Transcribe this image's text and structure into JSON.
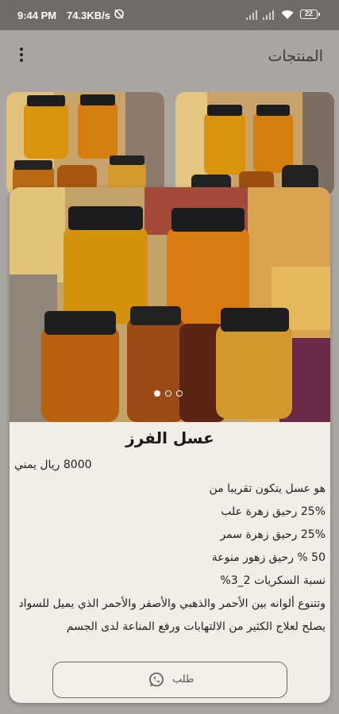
{
  "status_bar": {
    "time": "9:44 PM",
    "network_speed": "74.3KB/s",
    "battery": "22"
  },
  "app_bar": {
    "title": "المنتجات",
    "menu_icon": "more-vertical-icon"
  },
  "product": {
    "name": "عسل الفرز",
    "price": "8000 ريال يمني",
    "description": [
      "هو عسل يتكون تقريبا من",
      "25% رحيق زهرة علب",
      "25%  رحيق زهرة سمر",
      "50 % رحيق زهور منوعة",
      "نسبة السكريات 2_3%",
      "وتتنوع ألوانه بين الأحمر والذهبي والأصفر والأحمر الذي يميل للسواد",
      "يصلح لعلاج الكثير من الالتهابات ورفع المناعة لدى الجسم"
    ],
    "carousel": {
      "total": 3,
      "active": 0
    },
    "order_label": "طلب"
  },
  "colors": {
    "background": "#a9a5a1",
    "card": "#f2ede6",
    "honey": "#d08a17",
    "whatsapp_icon": "#555555"
  }
}
